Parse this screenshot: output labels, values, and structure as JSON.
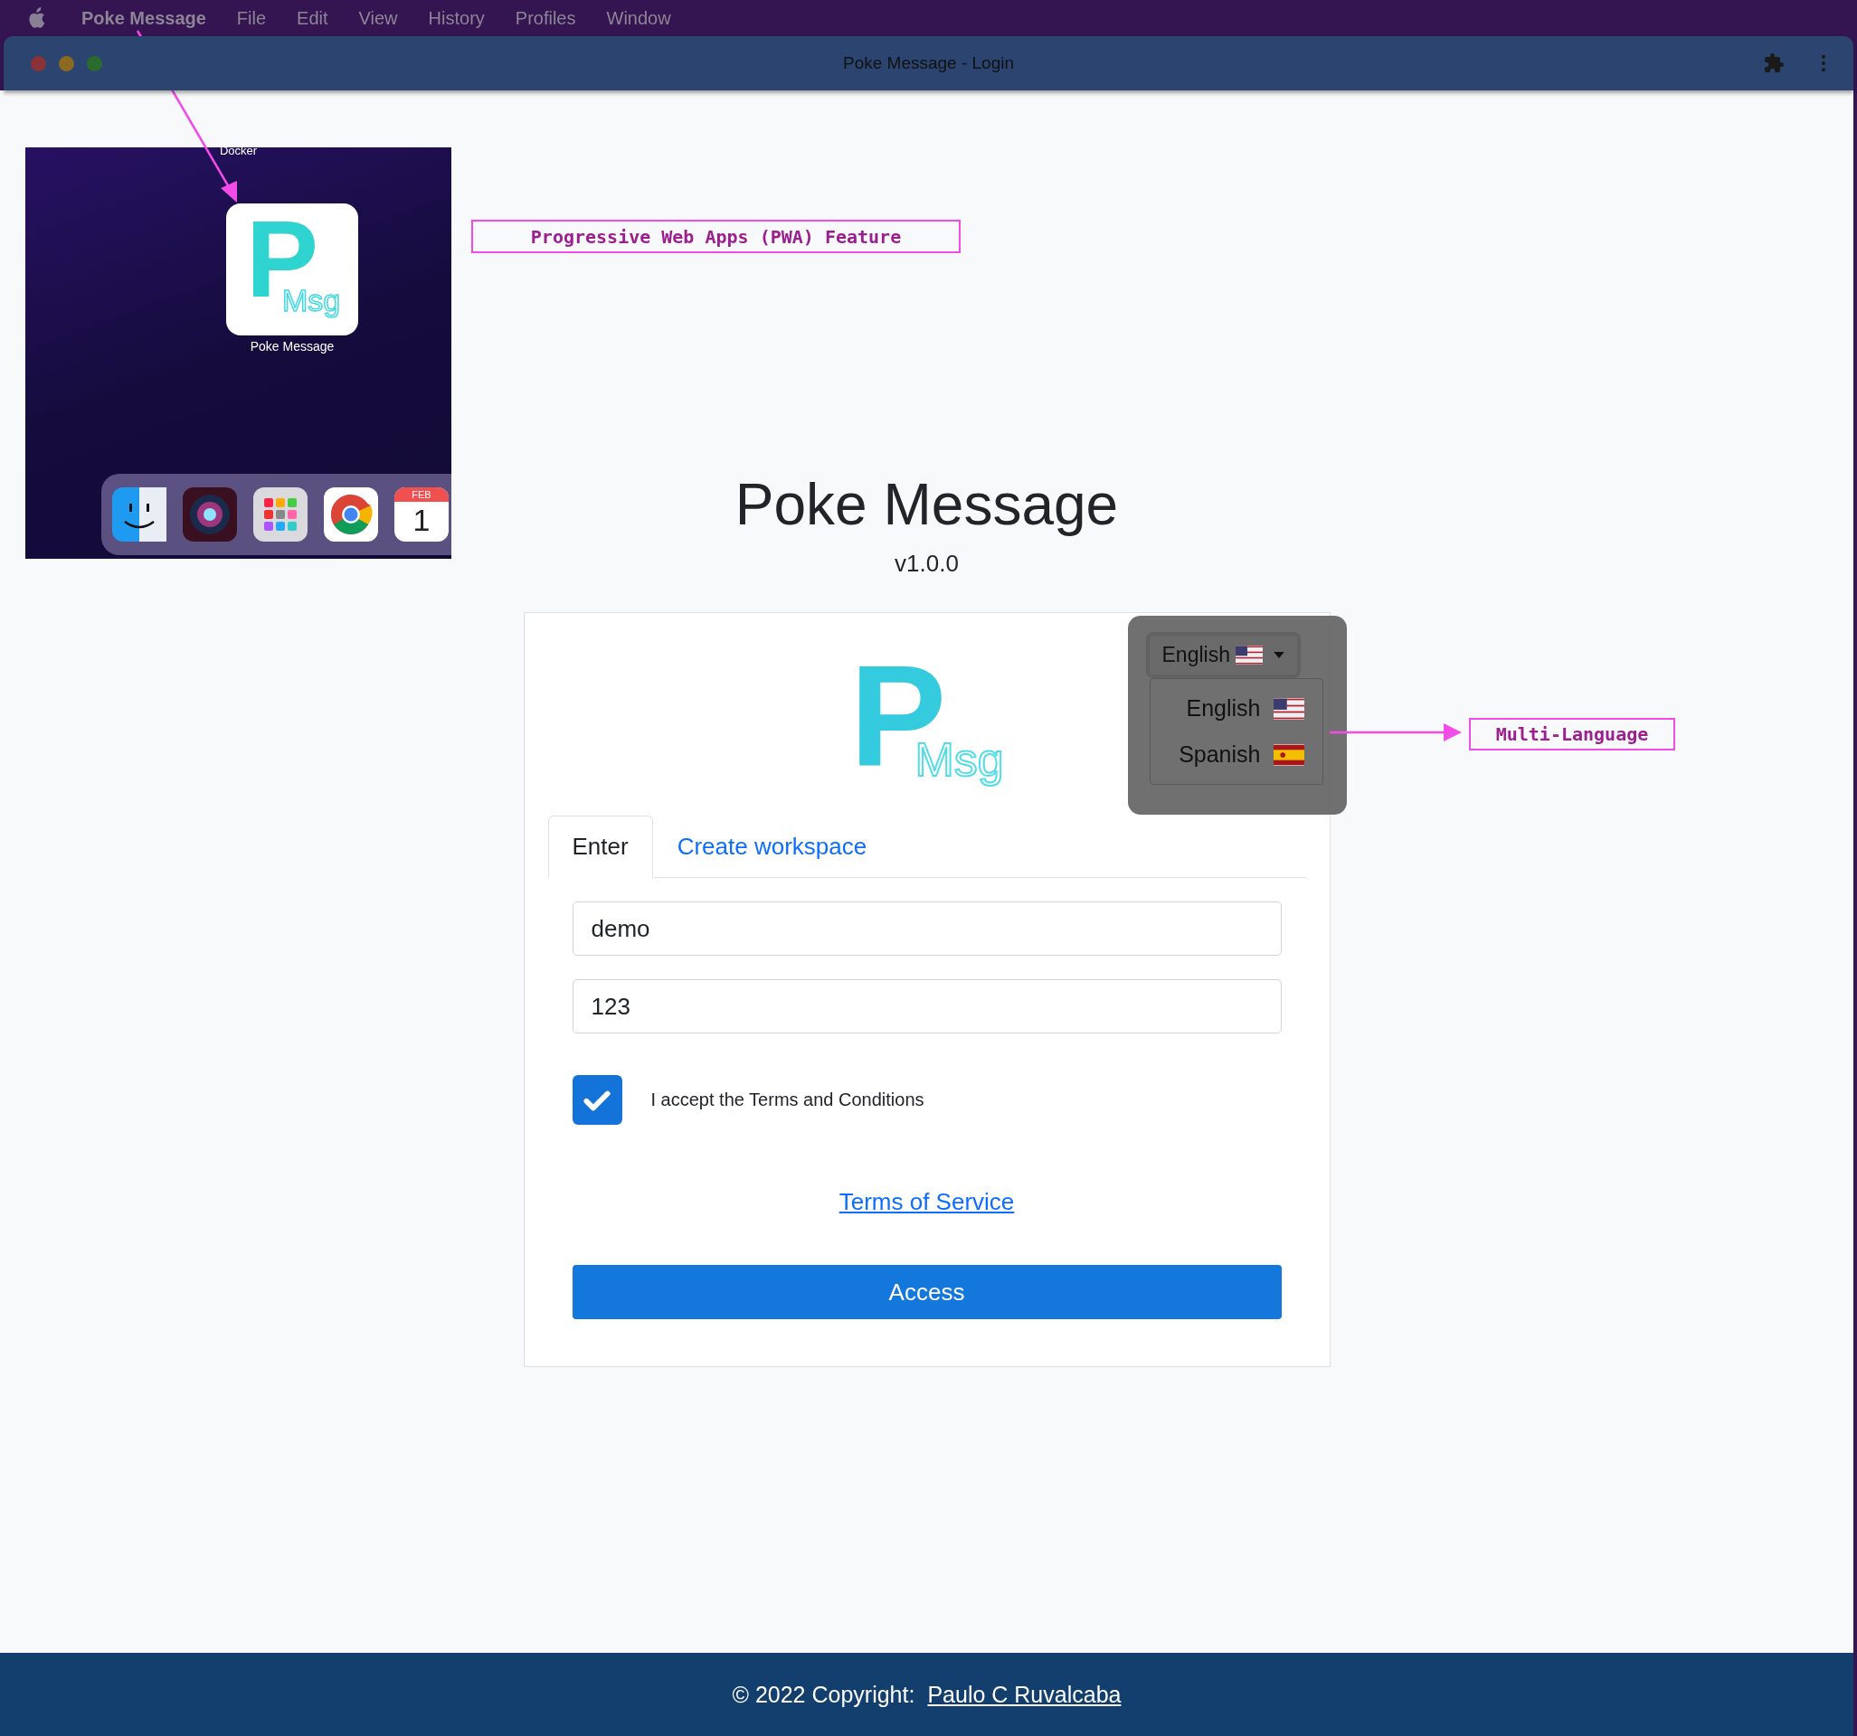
{
  "menu_bar": {
    "app_name": "Poke Message",
    "items": [
      "File",
      "Edit",
      "View",
      "History",
      "Profiles",
      "Window"
    ]
  },
  "window": {
    "title": "Poke Message - Login"
  },
  "desktop_inset": {
    "folder_label": "Docker",
    "app_icon": {
      "letter": "P",
      "text": "Msg"
    },
    "app_label": "Poke Message",
    "calendar_month": "FEB",
    "calendar_day": "1"
  },
  "annotations": [
    {
      "text": "Progressive Web Apps (PWA) Feature"
    },
    {
      "text": "Multi-Language"
    }
  ],
  "page": {
    "title": "Poke Message",
    "version": "v1.0.0"
  },
  "card_logo": {
    "letter": "P",
    "text": "Msg"
  },
  "language": {
    "current": "English",
    "kind": "us",
    "options": [
      {
        "label": "English",
        "kind": "us"
      },
      {
        "label": "Spanish",
        "kind": "es"
      }
    ]
  },
  "tabs": [
    {
      "label": "Enter",
      "selected": true
    },
    {
      "label": "Create workspace",
      "selected": false
    }
  ],
  "fields": [
    {
      "value": "demo"
    },
    {
      "value": "123"
    }
  ],
  "terms_checkbox": {
    "label": "I accept the Terms and Conditions",
    "checked": true
  },
  "terms_link": "Terms of Service",
  "access_button": "Access",
  "footer": {
    "text": "© 2022 Copyright:",
    "link": "Paulo C Ruvalcaba"
  }
}
